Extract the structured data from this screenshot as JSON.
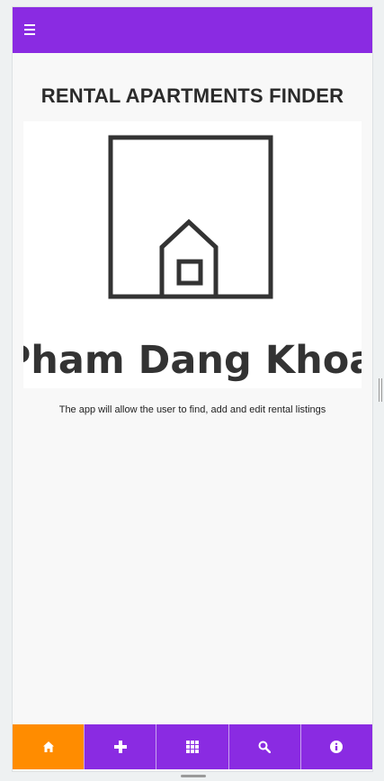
{
  "header": {
    "menu_icon": "hamburger-menu-icon",
    "bar_color": "#8a2be2"
  },
  "main": {
    "title": "RENTAL APARTMENTS FINDER",
    "logo": {
      "icon": "house-in-frame-icon",
      "name": "Pham Dang Khoa"
    },
    "description": "The app will allow the user to find, add and edit rental listings"
  },
  "bottom_nav": {
    "active_color": "#ff8c00",
    "items": [
      {
        "icon": "home-icon",
        "active": true
      },
      {
        "icon": "plus-icon",
        "active": false
      },
      {
        "icon": "grid-icon",
        "active": false
      },
      {
        "icon": "search-icon",
        "active": false
      },
      {
        "icon": "info-icon",
        "active": false
      }
    ]
  }
}
